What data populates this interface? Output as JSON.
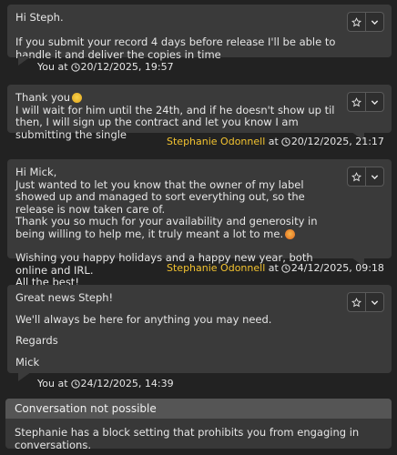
{
  "messages": [
    {
      "text": "Hi Steph.\n\nIf you submit your record 4 days before release I'll be able to handle it and deliver the copies in time",
      "author": "You",
      "at_word": "at",
      "timestamp": "20/12/2025, 19:57",
      "own": true
    },
    {
      "line1": "Thank you",
      "text": "I will wait for him until the 24th, and if he doesn't show up til then, I will sign up the contract and let you know I am submitting the single",
      "author": "Stephanie Odonnell",
      "at_word": "at",
      "timestamp": "20/12/2025, 21:17",
      "own": false
    },
    {
      "text_a": "Hi Mick,\nJust wanted to let you know that the owner of my label showed up and managed to sort everything out, so the release is now taken care of.\nThank you so much for your availability and generosity in being willing to help me, it truly meant a lot to me.",
      "text_b": "Wishing you happy holidays and a happy new year, both online and IRL.\nAll the best!",
      "author": "Stephanie Odonnell",
      "at_word": "at",
      "timestamp": "24/12/2025, 09:18",
      "own": false
    },
    {
      "p1": "Great news Steph!",
      "p2": "We'll always be here for anything you may need.",
      "p3": "Regards",
      "p4": "Mick",
      "author": "You",
      "at_word": "at",
      "timestamp": "24/12/2025, 14:39",
      "own": true
    }
  ],
  "notice": {
    "title": "Conversation not possible",
    "body": "Stephanie has a block setting that prohibits you from engaging in conversations."
  },
  "colors": {
    "background": "#222222",
    "bubble": "#3a3a3a",
    "author_name": "#f3c330",
    "notice_header": "#555555"
  },
  "icons": [
    "star-icon",
    "chevron-down-icon",
    "clock-icon",
    "smile-emoji-icon",
    "heart-eyes-emoji-icon"
  ]
}
